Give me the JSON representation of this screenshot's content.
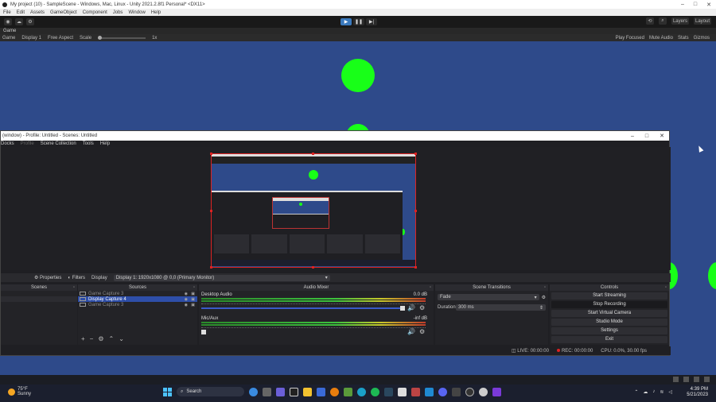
{
  "unity": {
    "title": "My project (10) - SampleScene - Windows, Mac, Linux - Unity 2021.2.8f1 Personal* <DX11>",
    "menu": [
      "File",
      "Edit",
      "Assets",
      "GameObject",
      "Component",
      "Jobs",
      "Window",
      "Help"
    ],
    "toolbar_right": [
      "Layers",
      "Layout"
    ],
    "tab": "Game",
    "game_bar": {
      "mode": "Game",
      "display": "Display 1",
      "aspect": "Free Aspect",
      "scale_label": "Scale",
      "scale_value": "1x",
      "right": [
        "Play Focused",
        "Mute Audio",
        "Stats",
        "Gizmos"
      ]
    }
  },
  "obs": {
    "title": "(window) - Profile: Untitled - Scenes: Untitled",
    "menu": [
      "Docks",
      "Profile",
      "Scene Collection",
      "Tools",
      "Help"
    ],
    "source_bar": {
      "properties": "Properties",
      "filters": "Filters",
      "display_label": "Display",
      "display_value": "Display 1: 1920x1080 @ 0,0 (Primary Monitor)"
    },
    "docks": {
      "scenes": "Scenes",
      "sources": "Sources",
      "mixer": "Audio Mixer",
      "transitions": "Scene Transitions",
      "controls": "Controls"
    },
    "sources": [
      {
        "name": "Game Capture 3"
      },
      {
        "name": "Display Capture 4"
      },
      {
        "name": "Game Capture 3"
      }
    ],
    "mixer": [
      {
        "name": "Desktop Audio",
        "db": "0.0 dB"
      },
      {
        "name": "Mic/Aux",
        "db": "-inf dB"
      }
    ],
    "transitions": {
      "type": "Fade",
      "duration_label": "Duration",
      "duration_value": "300 ms"
    },
    "controls": [
      "Start Streaming",
      "Stop Recording",
      "Start Virtual Camera",
      "Studio Mode",
      "Settings",
      "Exit"
    ],
    "status": {
      "live": "LIVE: 00:00:00",
      "rec": "REC: 00:00:00",
      "cpu": "CPU: 0.0%, 30.00 fps"
    }
  },
  "taskbar": {
    "temp": "75°F",
    "weather": "Sunny",
    "search": "Search",
    "time": "4:39 PM",
    "date": "5/21/2023"
  },
  "colors": {
    "game_bg": "#2e4a8a",
    "circle": "#18ff18",
    "accent": "#3a79bd"
  }
}
